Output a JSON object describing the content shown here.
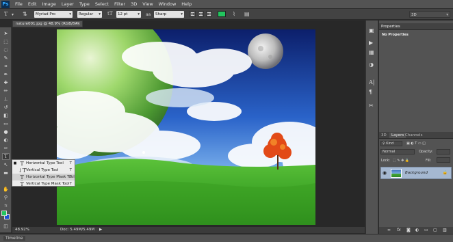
{
  "app": {
    "logo": "Ps"
  },
  "menu": [
    "File",
    "Edit",
    "Image",
    "Layer",
    "Type",
    "Select",
    "Filter",
    "3D",
    "View",
    "Window",
    "Help"
  ],
  "options_bar": {
    "font_family": "Myriad Pro",
    "font_style": "Regular",
    "font_size": "12 pt",
    "anti_alias": "Sharp",
    "text_color": "#22c55e",
    "workspace": "3D"
  },
  "document": {
    "tab_title": "nature001.jpg @ 48.9% (RGB/8#)",
    "close": "×"
  },
  "status": {
    "zoom": "48.92%",
    "doc": "Doc: 5.49M/5.49M",
    "arrow": "▶"
  },
  "timeline": {
    "label": "Timeline"
  },
  "type_flyout": {
    "items": [
      {
        "label": "Horizontal Type Tool",
        "key": "T",
        "bullet": "■"
      },
      {
        "label": "Vertical Type Tool",
        "key": "T",
        "bullet": ""
      },
      {
        "label": "Horizontal Type Mask Tool",
        "key": "T",
        "bullet": ""
      },
      {
        "label": "Vertical Type Mask Tool",
        "key": "T",
        "bullet": ""
      }
    ]
  },
  "properties_panel": {
    "tab": "Properties",
    "empty_text": "No Properties"
  },
  "layers_panel": {
    "tabs": [
      "3D",
      "Layers",
      "Channels"
    ],
    "filter_kind": "Kind",
    "blend_mode": "Normal",
    "opacity_label": "Opacity:",
    "lock_label": "Lock:",
    "fill_label": "Fill:",
    "layer_name": "Background"
  },
  "colors": {
    "foreground": "#22c55e",
    "background": "#1e4fd1",
    "layer_selected": "#a5b8d1"
  }
}
